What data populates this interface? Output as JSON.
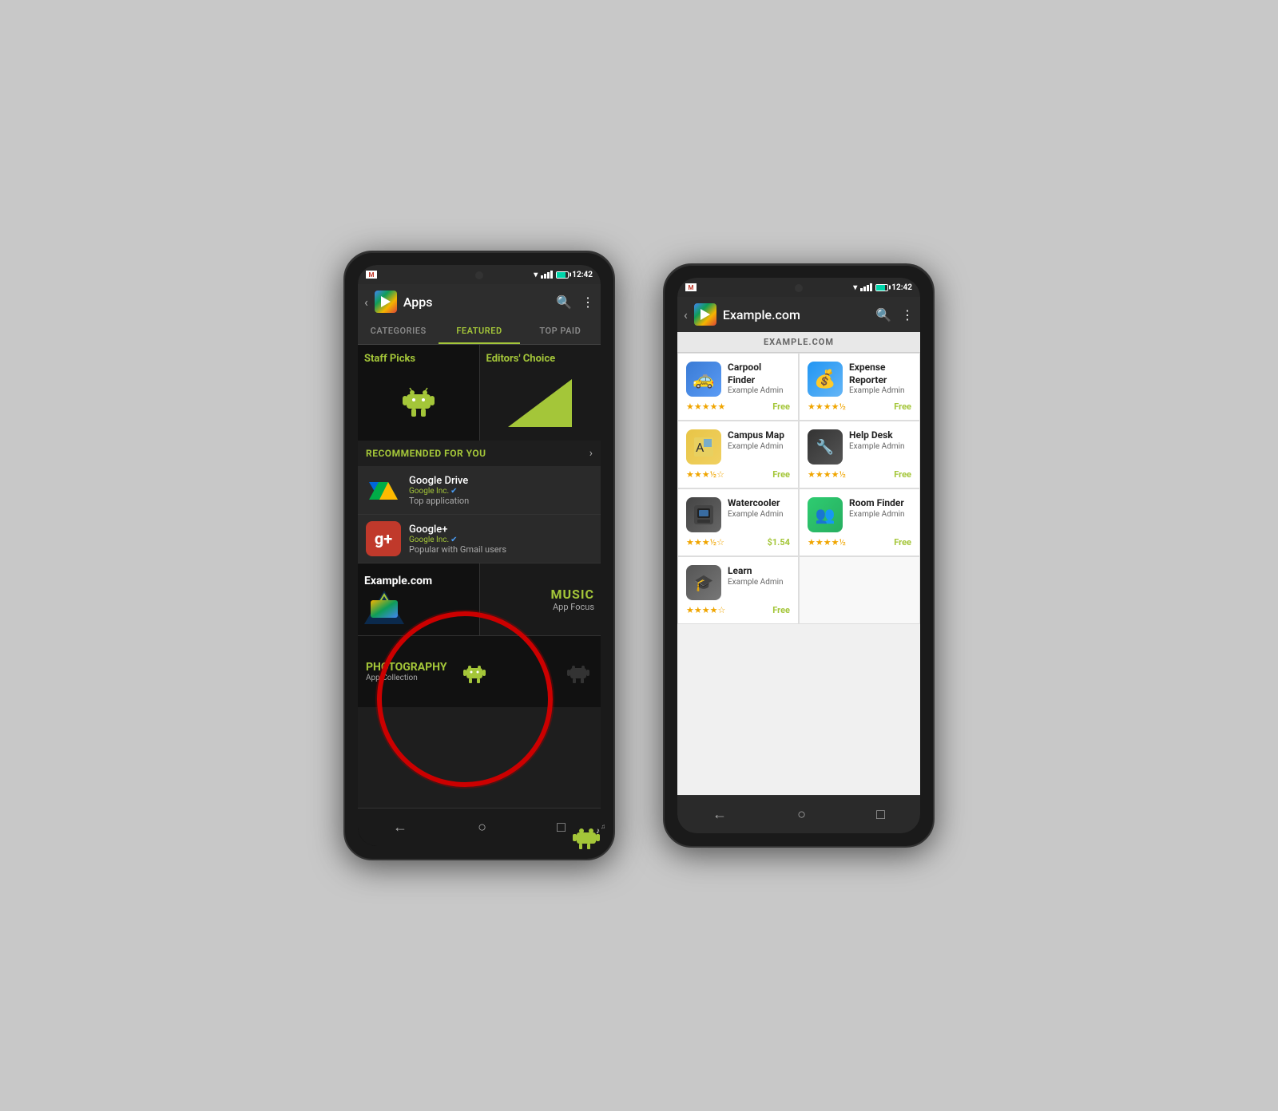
{
  "phone_left": {
    "status": {
      "time": "12:42"
    },
    "app_bar": {
      "title": "Apps",
      "back": "‹",
      "search": "🔍",
      "menu": "⋮"
    },
    "tabs": [
      {
        "label": "CATEGORIES",
        "active": false
      },
      {
        "label": "FEATURED",
        "active": true
      },
      {
        "label": "TOP PAID",
        "active": false
      }
    ],
    "banners": {
      "left": "Staff Picks",
      "right": "Editors' Choice"
    },
    "recommended": {
      "title": "RECOMMENDED FOR YOU",
      "apps": [
        {
          "name": "Google Drive",
          "developer": "Google Inc.",
          "subtitle": "Top application",
          "verified": true
        },
        {
          "name": "Google+",
          "developer": "Google Inc.",
          "subtitle": "Popular with Gmail users",
          "verified": true
        }
      ]
    },
    "promo": {
      "left_title": "Example.com",
      "right_title": "MUSIC",
      "right_sub": "App Focus"
    },
    "photo": {
      "title": "PHOTOGRAPHY",
      "sub": "App Collection"
    },
    "nav": [
      "←",
      "○",
      "□"
    ]
  },
  "phone_right": {
    "status": {
      "time": "12:42"
    },
    "app_bar": {
      "title": "Example.com",
      "back": "‹",
      "search": "🔍",
      "menu": "⋮"
    },
    "section_title": "EXAMPLE.COM",
    "apps": [
      {
        "name": "Carpool Finder",
        "developer": "Example Admin",
        "stars": 5,
        "price": "Free",
        "icon_type": "carpool",
        "icon_symbol": "🚕"
      },
      {
        "name": "Expense Reporter",
        "developer": "Example Admin",
        "stars": 4.5,
        "price": "Free",
        "icon_type": "expense",
        "icon_symbol": "💰"
      },
      {
        "name": "Campus Map",
        "developer": "Example Admin",
        "stars": 3.5,
        "price": "Free",
        "icon_type": "campus",
        "icon_symbol": "🗺"
      },
      {
        "name": "Help Desk",
        "developer": "Example Admin",
        "stars": 4.5,
        "price": "Free",
        "icon_type": "helpdesk",
        "icon_symbol": "🔧"
      },
      {
        "name": "Watercooler",
        "developer": "Example Admin",
        "stars": 3.5,
        "price": "$1.54",
        "icon_type": "watercooler",
        "icon_symbol": "🖥"
      },
      {
        "name": "Room Finder",
        "developer": "Example Admin",
        "stars": 4.5,
        "price": "Free",
        "icon_type": "roomfinder",
        "icon_symbol": "👥"
      },
      {
        "name": "Learn",
        "developer": "Example Admin",
        "stars": 4,
        "price": "Free",
        "icon_type": "learn",
        "icon_symbol": "🎓"
      }
    ],
    "nav": [
      "←",
      "○",
      "□"
    ]
  },
  "icons": {
    "search": "⌕",
    "menu": "⋮",
    "back": "‹"
  },
  "colors": {
    "accent": "#a4c639",
    "background_dark": "#1e1e1e",
    "background_light": "#f0f0f0",
    "text_dark": "#ffffff",
    "text_muted": "#aaaaaa",
    "play_blue": "#4285f4"
  }
}
